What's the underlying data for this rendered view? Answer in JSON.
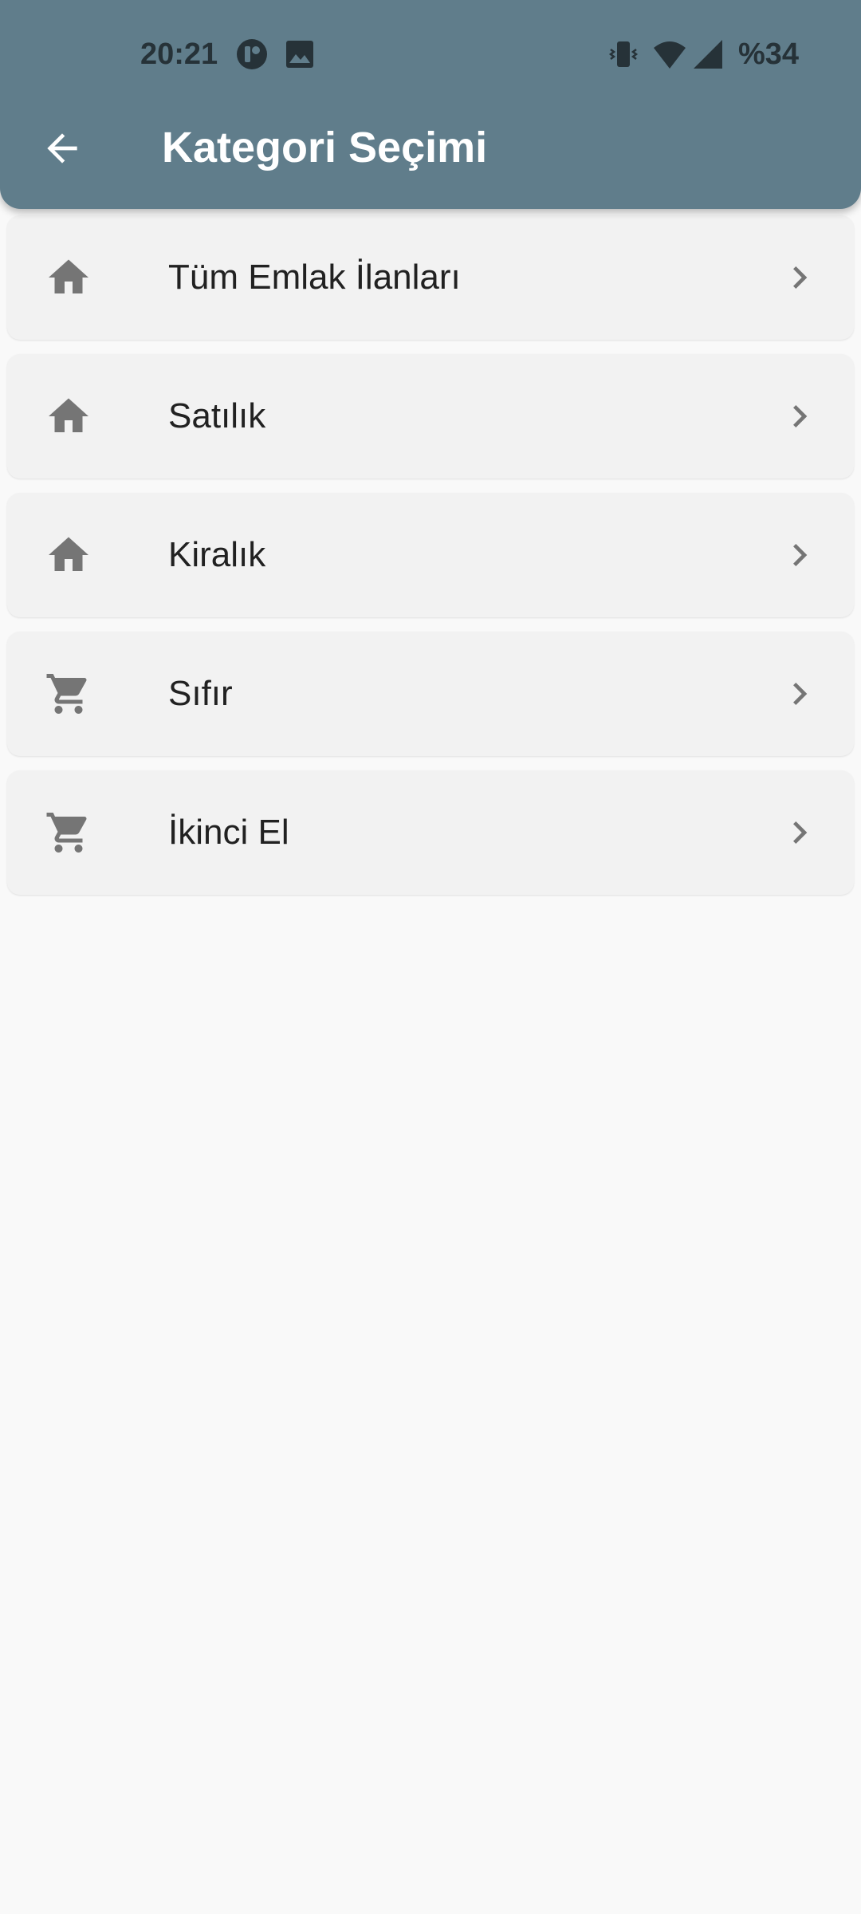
{
  "status_bar": {
    "time": "20:21",
    "battery": "%34",
    "icons": [
      "app-notification-icon",
      "image-icon",
      "vibrate-icon",
      "wifi-icon",
      "signal-icon"
    ]
  },
  "app_bar": {
    "title": "Kategori Seçimi",
    "back_icon": "arrow-back-icon",
    "background": "#607d8b"
  },
  "categories": [
    {
      "label": "Tüm Emlak İlanları",
      "icon": "home-icon"
    },
    {
      "label": "Satılık",
      "icon": "home-icon"
    },
    {
      "label": "Kiralık",
      "icon": "home-icon"
    },
    {
      "label": "Sıfır",
      "icon": "cart-icon"
    },
    {
      "label": "İkinci El",
      "icon": "cart-icon"
    }
  ],
  "colors": {
    "icon": "#757575",
    "row_background": "#f2f2f2",
    "page_background": "#f9f9f9"
  }
}
